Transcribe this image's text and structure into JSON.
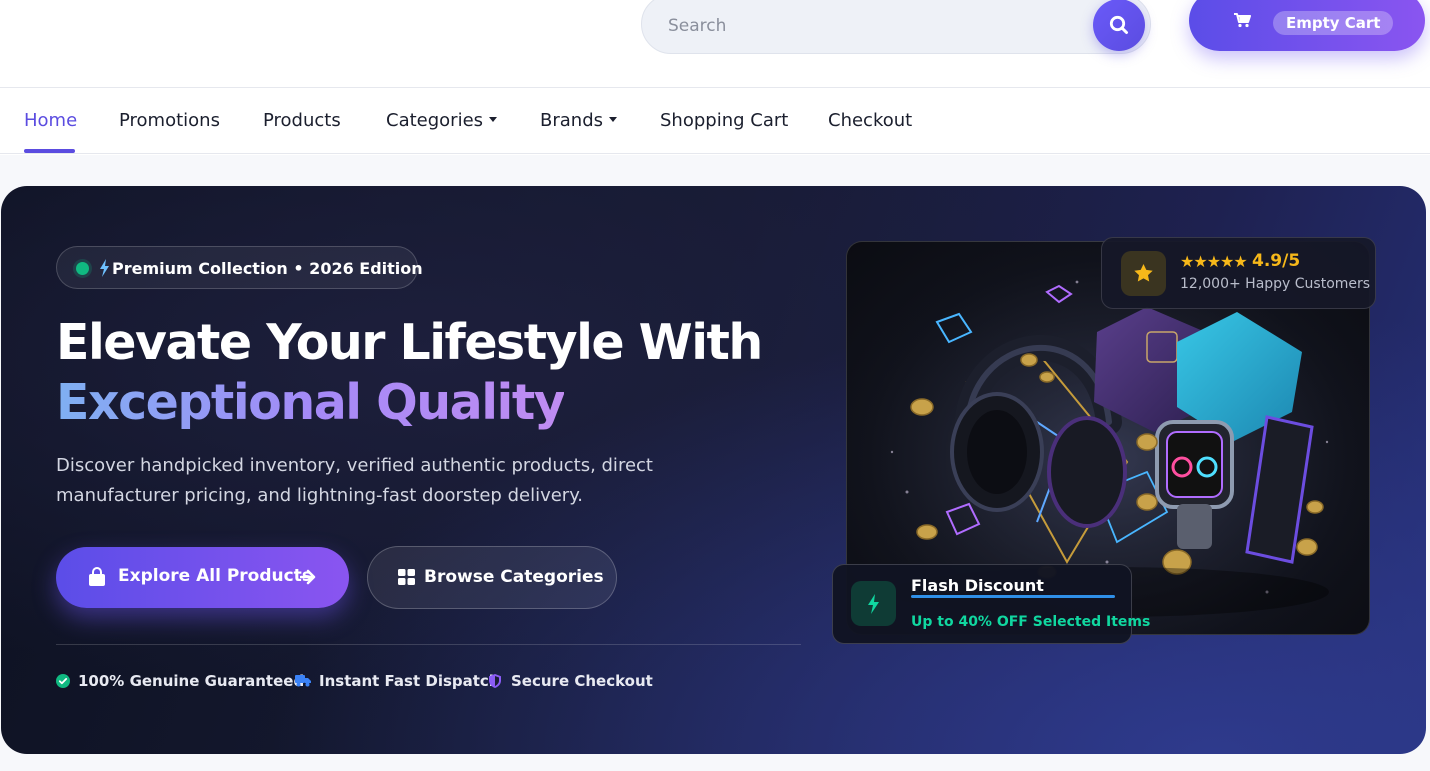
{
  "header": {
    "search_placeholder": "Search",
    "cart_label": "Empty Cart"
  },
  "nav": {
    "items": [
      {
        "label": "Home",
        "active": true
      },
      {
        "label": "Promotions"
      },
      {
        "label": "Products"
      },
      {
        "label": "Categories",
        "dropdown": true
      },
      {
        "label": "Brands",
        "dropdown": true
      },
      {
        "label": "Shopping Cart"
      },
      {
        "label": "Checkout"
      }
    ]
  },
  "hero": {
    "badge": "Premium Collection • 2026 Edition",
    "title_line1": "Elevate Your Lifestyle With",
    "title_line2": "Exceptional Quality",
    "description": "Discover handpicked inventory, verified authentic products, direct manufacturer pricing, and lightning-fast doorstep delivery.",
    "primary_button": "Explore All Products",
    "secondary_button": "Browse Categories",
    "trust": [
      {
        "label": "100% Genuine Guaranteed",
        "icon": "check-circle-icon",
        "color": "#10b981"
      },
      {
        "label": "Instant Fast Dispatch",
        "icon": "truck-icon",
        "color": "#3b82f6"
      },
      {
        "label": "Secure Checkout",
        "icon": "shield-icon",
        "color": "#8b5cf6"
      }
    ]
  },
  "rating_card": {
    "stars": "★★★★★",
    "score": "4.9/5",
    "subtitle": "12,000+ Happy Customers"
  },
  "flash_card": {
    "title": "Flash Discount",
    "subtitle": "Up to 40% OFF Selected Items"
  },
  "colors": {
    "accent": "#5b4ce0",
    "accent_gradient_end": "#8a55f0",
    "hero_bg": "#161a33",
    "success": "#10b981",
    "star": "#f6b81a"
  }
}
